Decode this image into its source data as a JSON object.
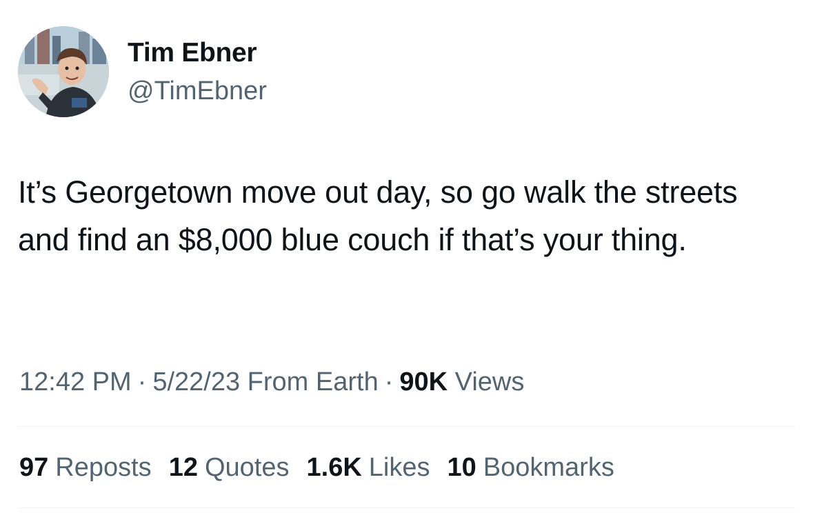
{
  "author": {
    "display_name": "Tim Ebner",
    "handle": "@TimEbner"
  },
  "tweet": {
    "text": "It’s Georgetown move out day, so go walk the streets and find an $8,000 blue couch if that’s your thing."
  },
  "meta": {
    "time": "12:42 PM",
    "separator": "·",
    "date": "5/22/23",
    "source": "From Earth",
    "views_count": "90K",
    "views_label": "Views"
  },
  "stats": {
    "reposts": {
      "count": "97",
      "label": "Reposts"
    },
    "quotes": {
      "count": "12",
      "label": "Quotes"
    },
    "likes": {
      "count": "1.6K",
      "label": "Likes"
    },
    "bookmarks": {
      "count": "10",
      "label": "Bookmarks"
    }
  },
  "colors": {
    "text_primary": "#0f1419",
    "text_secondary": "#536471",
    "divider": "#eff3f4"
  }
}
